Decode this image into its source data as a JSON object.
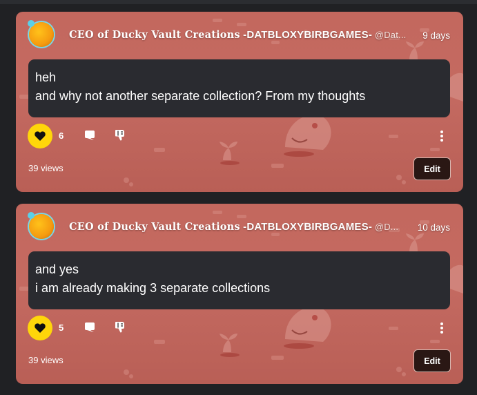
{
  "posts": [
    {
      "display_name_part1": "CEO of Ducky Vault Creations",
      "display_name_part2": " -DATBLOXYBIRBGAMES-",
      "handle": " @Dat...",
      "time": "9 days",
      "lines": [
        "heh",
        "and why not another separate collection? From my thoughts"
      ],
      "likes": "6",
      "views": "39 views",
      "edit_label": "Edit"
    },
    {
      "display_name_part1": "CEO of Ducky Vault Creations",
      "display_name_part2": " -DATBLOXYBIRBGAMES-",
      "handle": " @D...",
      "time": "10 days",
      "lines": [
        "and yes",
        "i am already making 3 separate collections"
      ],
      "likes": "5",
      "views": "39 views",
      "edit_label": "Edit"
    }
  ],
  "icons": {
    "like": "heart-icon",
    "reply": "speech-bubble-icon",
    "dislike": "thumbs-down-icon",
    "more": "vertical-dots-icon"
  },
  "colors": {
    "page_bg": "#202124",
    "card_bg": "#c3685e",
    "bubble_bg": "#2a2b30",
    "like_active": "#ffd60a",
    "edit_bg": "#2a1714"
  }
}
